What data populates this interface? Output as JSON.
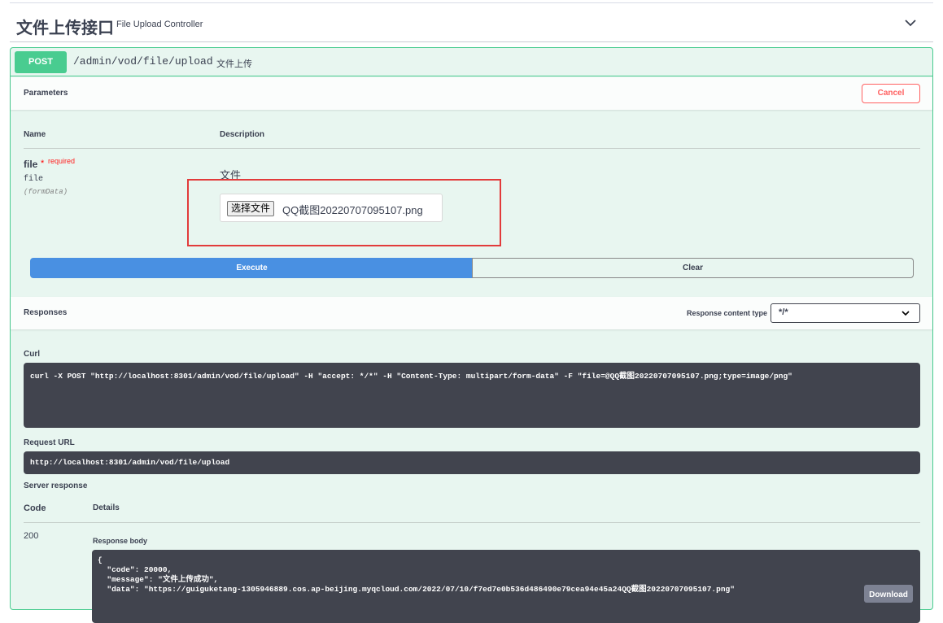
{
  "tag": {
    "title": "文件上传接口",
    "subtitle": "File Upload Controller"
  },
  "operation": {
    "method": "POST",
    "path": "/admin/vod/file/upload",
    "summary": "文件上传"
  },
  "parameters": {
    "header": "Parameters",
    "cancel_label": "Cancel",
    "col_name": "Name",
    "col_description": "Description",
    "param": {
      "name": "file",
      "required_star": "*",
      "required_label": "required",
      "type": "file",
      "in": "(formData)",
      "description": "文件",
      "choose_button": "选择文件",
      "file_name": "QQ截图20220707095107.png"
    },
    "execute_label": "Execute",
    "clear_label": "Clear"
  },
  "responses": {
    "header": "Responses",
    "content_type_label": "Response content type",
    "content_type_value": "*/*",
    "curl_label": "Curl",
    "curl_command": "curl -X POST \"http://localhost:8301/admin/vod/file/upload\" -H \"accept: */*\" -H \"Content-Type: multipart/form-data\" -F \"file=@QQ截图20220707095107.png;type=image/png\"",
    "request_url_label": "Request URL",
    "request_url": "http://localhost:8301/admin/vod/file/upload",
    "server_response_label": "Server response",
    "col_code": "Code",
    "col_details": "Details",
    "code": "200",
    "response_body_label": "Response body",
    "response_body": "{\n  \"code\": 20000,\n  \"message\": \"文件上传成功\",\n  \"data\": \"https://guiguketang-1305946889.cos.ap-beijing.myqcloud.com/2022/07/10/f7ed7e0b536d486490e79cea94e45a24QQ截图20220707095107.png\"",
    "download_label": "Download"
  },
  "colors": {
    "post_green": "#49cc90",
    "execute_blue": "#4990e2",
    "cancel_red": "#ff6060",
    "highlight_red": "#e23b3b",
    "code_bg": "#41444e"
  }
}
